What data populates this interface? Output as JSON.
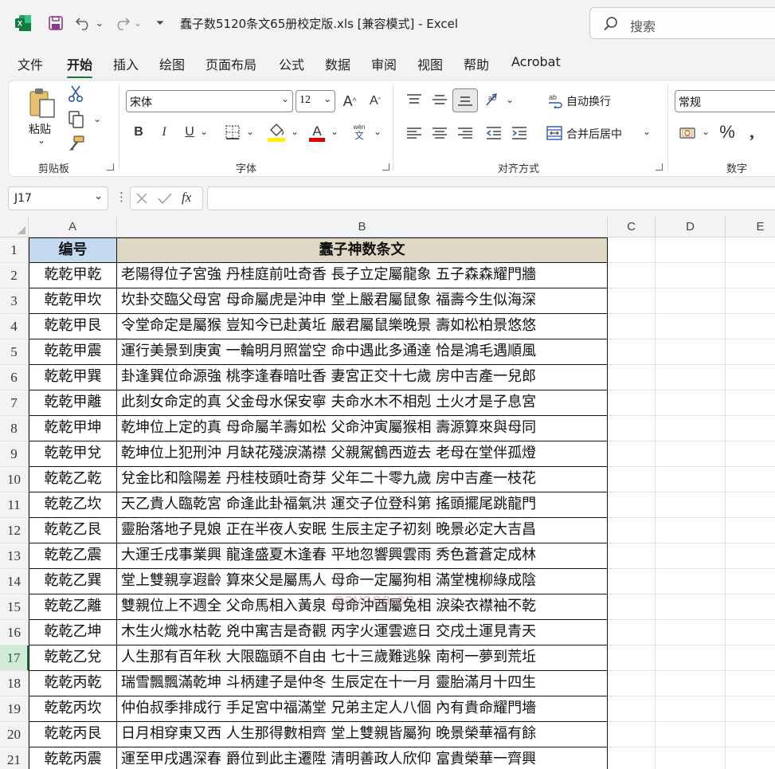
{
  "window": {
    "title": "蠢子数5120条文65册校定版.xls  [兼容模式]  -  Excel",
    "search_placeholder": "搜索"
  },
  "menu": {
    "tabs": [
      {
        "label": "文件"
      },
      {
        "label": "开始"
      },
      {
        "label": "插入"
      },
      {
        "label": "绘图"
      },
      {
        "label": "页面布局"
      },
      {
        "label": "公式"
      },
      {
        "label": "数据"
      },
      {
        "label": "审阅"
      },
      {
        "label": "视图"
      },
      {
        "label": "帮助"
      },
      {
        "label": "Acrobat"
      }
    ],
    "active": "开始"
  },
  "ribbon": {
    "clipboard": {
      "paste_label": "粘贴",
      "group_label": "剪贴板"
    },
    "font": {
      "font_name": "宋体",
      "font_size": "12",
      "wen_label": "wén",
      "wen_char": "文",
      "group_label": "字体"
    },
    "alignment": {
      "wrap_text": "自动换行",
      "merge_center": "合并后居中",
      "group_label": "对齐方式"
    },
    "number": {
      "format": "常规",
      "group_label": "数字"
    }
  },
  "formula_bar": {
    "name_box": "J17",
    "fx_label": "fx",
    "formula": ""
  },
  "colors": {
    "accent": "#1e6f3a",
    "header_a_fill": "#c5d9f1",
    "header_b_fill": "#ddd9c4"
  },
  "sheet": {
    "columns": [
      "A",
      "B",
      "C",
      "D",
      "E"
    ],
    "active_row": "17",
    "watermark": "nayona.cn",
    "rows": [
      {
        "num": "1",
        "a": "编号",
        "b": "蠢子神数条文"
      },
      {
        "num": "2",
        "a": "乾乾甲乾",
        "b": "老陽得位子宮強 丹桂庭前吐奇香 長子立定屬龍象 五子森森耀門牆"
      },
      {
        "num": "3",
        "a": "乾乾甲坎",
        "b": "坎卦交臨父母宮 母命屬虎是沖申 堂上嚴君屬鼠象 福壽今生似海深"
      },
      {
        "num": "4",
        "a": "乾乾甲艮",
        "b": "令堂命定是屬猴 豈知今已赴黃坵 嚴君屬鼠樂晚景 壽如松柏景悠悠"
      },
      {
        "num": "5",
        "a": "乾乾甲震",
        "b": "運行美景到庚寅 一輪明月照當空 命中遇此多通達 恰是鴻毛遇順風"
      },
      {
        "num": "6",
        "a": "乾乾甲巽",
        "b": "卦逢巽位命源強 桃李逢春暗吐香 妻宮正交十七歲 房中吉產一兒郎"
      },
      {
        "num": "7",
        "a": "乾乾甲離",
        "b": "此刻女命定的真 父金母水保安寧 夫命水木不相剋 土火才是子息宮"
      },
      {
        "num": "8",
        "a": "乾乾甲坤",
        "b": "乾坤位上定的真 母命屬羊壽如松 父命沖寅屬猴相 壽源算來與母同"
      },
      {
        "num": "9",
        "a": "乾乾甲兌",
        "b": "乾坤位上犯刑沖 月缺花殘淚滿襟 父親駕鶴西遊去 老母在堂伴孤燈"
      },
      {
        "num": "10",
        "a": "乾乾乙乾",
        "b": "兌金比和陰陽差 丹桂枝頭吐奇芽 父年二十零九歲 房中吉產一枝花"
      },
      {
        "num": "11",
        "a": "乾乾乙坎",
        "b": "天乙貴人臨乾宮 命逢此卦福氣洪 運交子位登科第 搖頭擺尾跳龍門"
      },
      {
        "num": "12",
        "a": "乾乾乙艮",
        "b": "靈胎落地子見娘 正在半夜人安眠 生辰主定子初刻 晚景必定大吉昌"
      },
      {
        "num": "13",
        "a": "乾乾乙震",
        "b": "大運壬戌事業興 龍逢盛夏木逢春 平地忽響興雲雨 秀色蒼蒼定成林"
      },
      {
        "num": "14",
        "a": "乾乾乙巽",
        "b": "堂上雙親享遐齡 算來父是屬馬人 母命一定屬狗相 滿堂槐柳綠成陰"
      },
      {
        "num": "15",
        "a": "乾乾乙離",
        "b": "雙親位上不週全 父命馬相入黃泉 母命沖酉屬兔相 淚染衣襟袖不乾"
      },
      {
        "num": "16",
        "a": "乾乾乙坤",
        "b": "木生火熾水枯乾 兇中寓吉是奇觀 丙字火運雲遮日 交戌土運見青天"
      },
      {
        "num": "17",
        "a": "乾乾乙兌",
        "b": "人生那有百年秋 大限臨頭不自由 七十三歲難逃躲 南柯一夢到荒坵"
      },
      {
        "num": "18",
        "a": "乾乾丙乾",
        "b": "瑞雪飄飄滿乾坤 斗柄建子是仲冬 生辰定在十一月 靈胎滿月十四生"
      },
      {
        "num": "19",
        "a": "乾乾丙坎",
        "b": "仲伯叔季排成行 手足宮中福滿堂 兄弟主定人八個 內有貴命耀門墻"
      },
      {
        "num": "20",
        "a": "乾乾丙艮",
        "b": "日月相穿東又西 人生那得數相齊 堂上雙親皆屬狗 晚景榮華福有餘"
      },
      {
        "num": "21",
        "a": "乾乾丙震",
        "b": "運至甲戌遇深春 爵位到此主遷陞 清明善政人欣仰 富貴榮華一齊興"
      }
    ]
  }
}
